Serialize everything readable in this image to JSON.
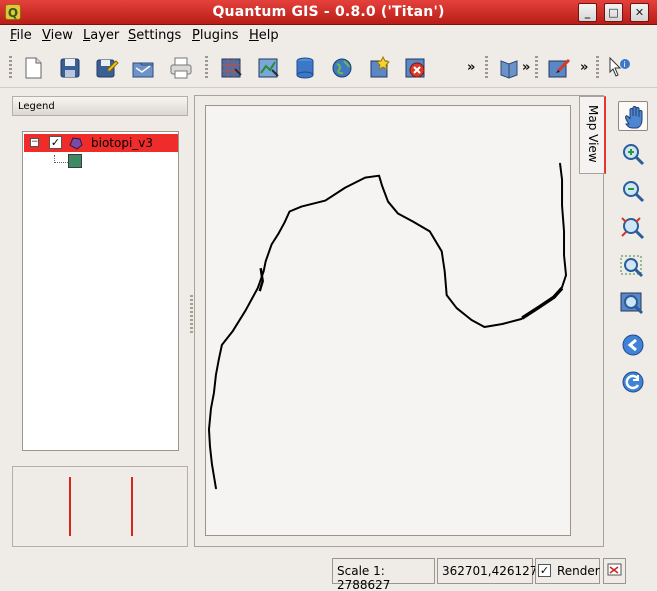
{
  "window": {
    "title": "Quantum GIS - 0.8.0 ('Titan')",
    "icon": "qgis-logo-icon",
    "buttons": [
      "minimize-icon",
      "maximize-icon",
      "close-icon"
    ]
  },
  "menu": {
    "items": [
      {
        "label": "File",
        "accel": "F"
      },
      {
        "label": "View",
        "accel": "V"
      },
      {
        "label": "Layer",
        "accel": "L"
      },
      {
        "label": "Settings",
        "accel": "S"
      },
      {
        "label": "Plugins",
        "accel": "P"
      },
      {
        "label": "Help",
        "accel": "H"
      }
    ]
  },
  "toolbar": {
    "overflow_label": "»",
    "icons": [
      "new-project-icon",
      "save-project-icon",
      "save-project-as-icon",
      "open-project-icon",
      "print-icon",
      "add-raster-layer-icon",
      "add-vector-layer-icon",
      "add-postgis-layer-icon",
      "add-wms-layer-icon",
      "new-vector-layer-icon",
      "remove-layer-icon",
      "help-book-icon",
      "capture-tool-icon",
      "identify-icon"
    ]
  },
  "legend": {
    "title": "Legend",
    "layers": [
      {
        "name": "biotopi_v3",
        "checked": true,
        "expander": "−",
        "symbol_color": "#3e8a67",
        "highlight": "#ef2c2a"
      }
    ]
  },
  "map": {
    "tab_label": "Map View",
    "line_color": "#000000",
    "background": "#f5f4f2"
  },
  "map_tools": [
    "pan-icon",
    "zoom-in-icon",
    "zoom-out-icon",
    "zoom-full-icon",
    "zoom-to-selection-icon",
    "zoom-to-layer-icon",
    "zoom-last-icon",
    "refresh-icon"
  ],
  "status": {
    "scale": "Scale 1: 2788627",
    "coordinates": "362701,426127",
    "render_label": "Render",
    "render_checked": true
  }
}
